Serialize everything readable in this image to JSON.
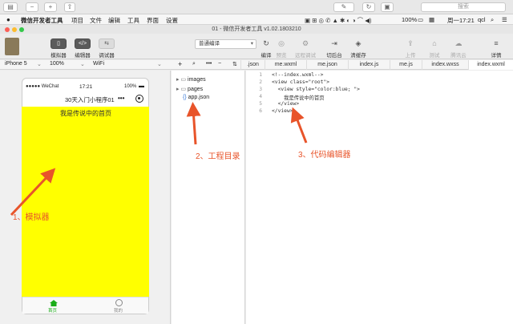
{
  "browser": {
    "search_placeholder": "搜索"
  },
  "menubar": {
    "apple": "",
    "items": [
      "微信开发者工具",
      "项目",
      "文件",
      "编辑",
      "工具",
      "界面",
      "设置"
    ],
    "battery": "100%",
    "datetime": "周一17:21",
    "user": "qcl"
  },
  "window": {
    "title": "01 - 微信开发者工具 v1.02.1803210"
  },
  "toolbar": {
    "left": [
      {
        "label": "模拟器",
        "glyph": "▯"
      },
      {
        "label": "编辑器",
        "glyph": "</>"
      },
      {
        "label": "调试器",
        "glyph": "⇆"
      }
    ],
    "compile_mode": "普通编译",
    "actions": [
      "编译",
      "预览",
      "远程调试",
      "切后台",
      "清缓存"
    ],
    "right": [
      "上传",
      "测试",
      "腾讯云",
      "详情"
    ]
  },
  "subbar": {
    "device": "iPhone 5",
    "zoom": "100%",
    "network": "WiFi"
  },
  "tabs": [
    ".json",
    "me.wxml",
    "me.json",
    "index.js",
    "me.js",
    "index.wxss",
    "index.wxml"
  ],
  "simulator": {
    "carrier": "●●●●● WeChat",
    "time": "17:21",
    "battery": "100%",
    "nav_title": "30天入门小程序01",
    "menu_dots": "•••",
    "page_text": "我是传说中的首页",
    "tabbar": [
      "首页",
      "我的"
    ]
  },
  "files": [
    {
      "name": "images",
      "type": "folder"
    },
    {
      "name": "pages",
      "type": "folder"
    },
    {
      "name": "app.json",
      "type": "file"
    }
  ],
  "code": {
    "lines": [
      "<!--index.wxml-->",
      "<view class=\"root\">",
      "  <view style=\"color:blue; \">",
      "    我是传说中的首页",
      "  </view>",
      "</view>"
    ],
    "numbers": [
      "1",
      "2",
      "3",
      "4",
      "5",
      "6"
    ]
  },
  "annotations": [
    "1、模拟器",
    "2、工程目录",
    "3、代码编辑器"
  ],
  "colors": {
    "accent": "#1aad19",
    "annotation": "#e8542a",
    "sim_bg": "#ffff00"
  }
}
